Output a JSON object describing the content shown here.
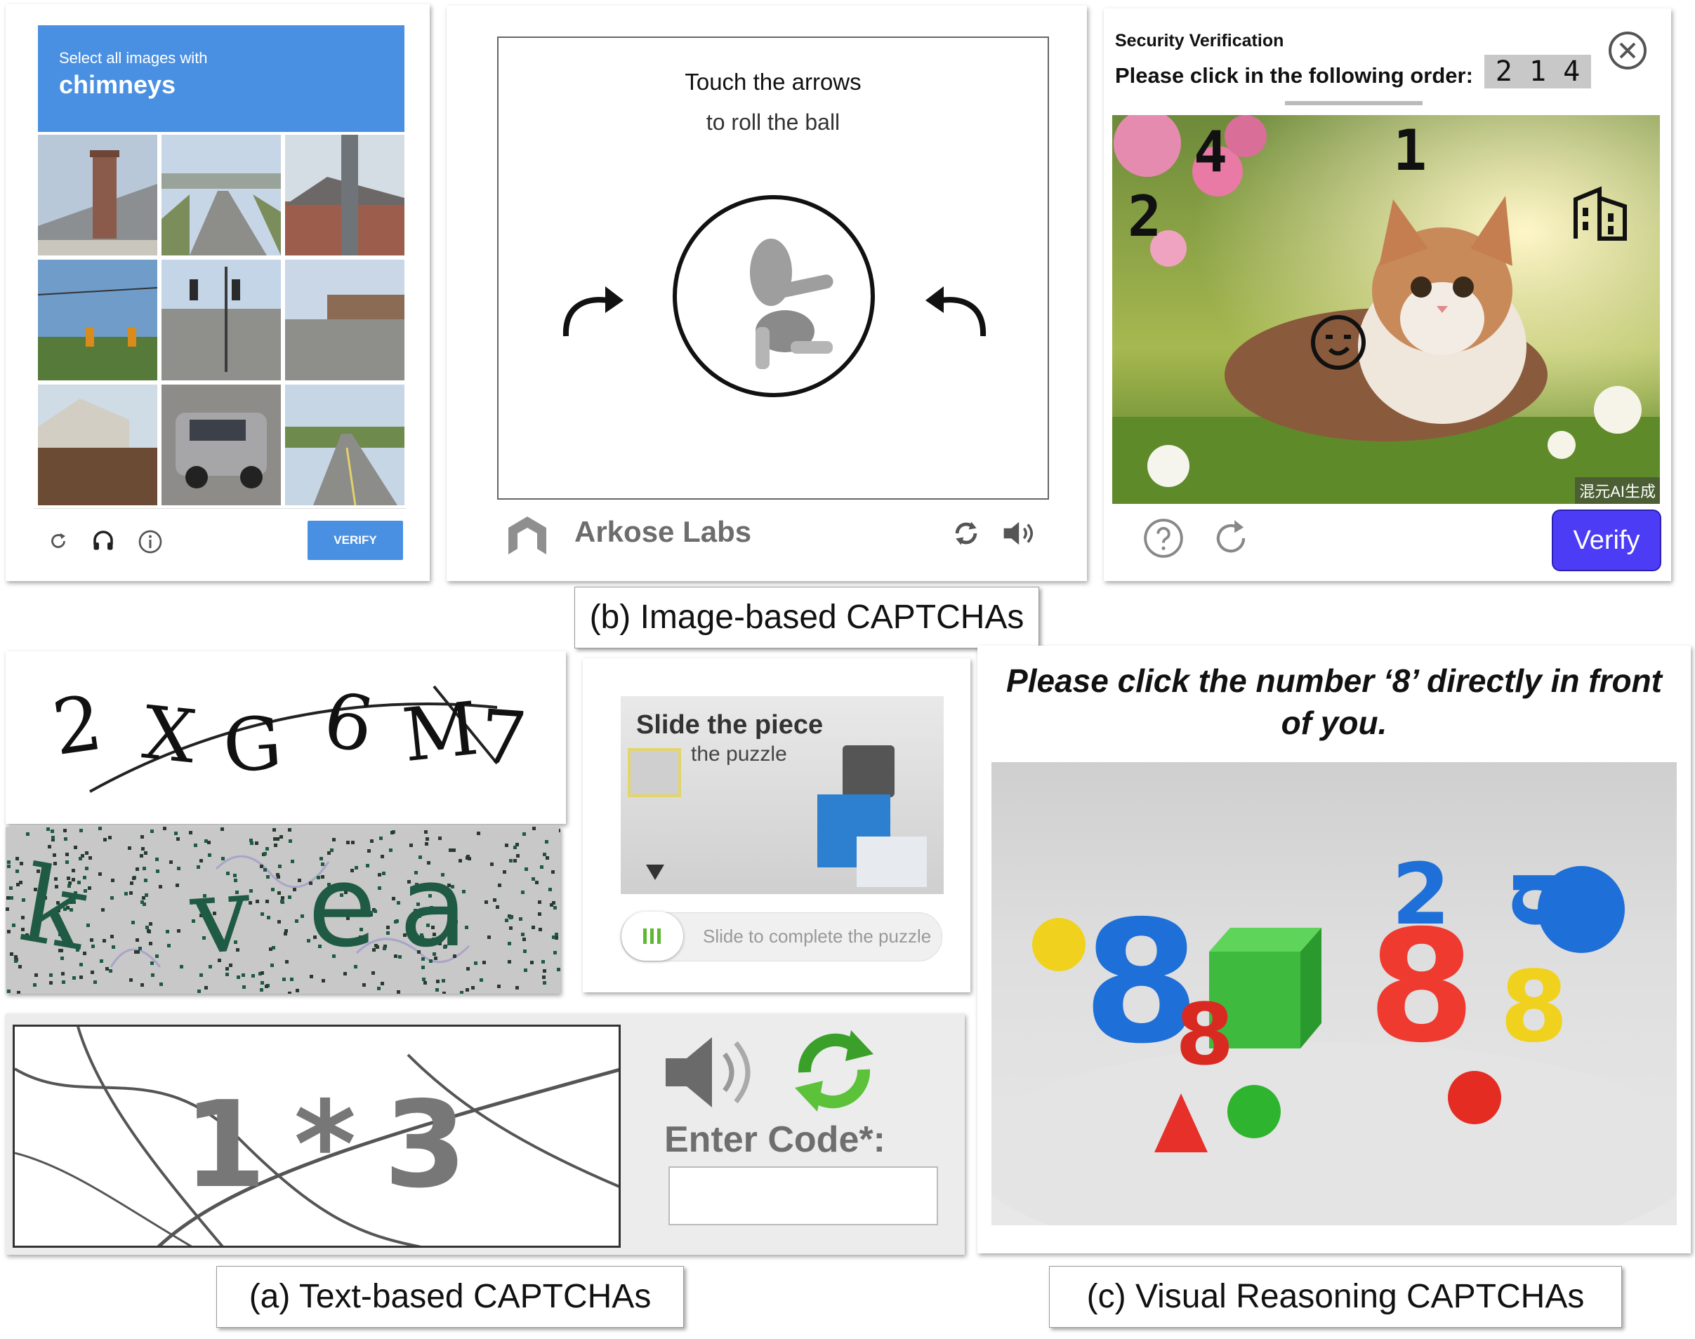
{
  "recaptcha": {
    "instruction": "Select all images with",
    "target": "chimneys",
    "verify_label": "VERIFY",
    "icons": [
      "reload-icon",
      "headphones-icon",
      "info-icon"
    ],
    "accent": "#4a90e2"
  },
  "arkose": {
    "title": "Touch the arrows",
    "subtitle": "to roll the ball",
    "brand": "Arkose Labs",
    "icons": [
      "refresh-icon",
      "speaker-icon"
    ]
  },
  "security": {
    "title": "Security Verification",
    "instruction": "Please click in the following order:",
    "order_code": "2 1 4",
    "digits": [
      "2",
      "4",
      "1"
    ],
    "watermark": "混元AI生成",
    "verify_label": "Verify",
    "accent": "#4c3cf5",
    "icons": [
      "close-icon",
      "help-icon",
      "refresh-icon",
      "building-icon",
      "smiley-icon"
    ]
  },
  "captions": {
    "b": "(b) Image-based CAPTCHAs",
    "a": "(a) Text-based CAPTCHAs",
    "c": "(c) Visual Reasoning CAPTCHAs"
  },
  "text_captcha_1": {
    "chars": [
      "2",
      "X",
      "G",
      "6",
      "M",
      "7"
    ]
  },
  "text_captcha_2": {
    "chars": [
      "k",
      "v",
      "e",
      "a"
    ],
    "color": "#1e5a44"
  },
  "slide_puzzle": {
    "title": "Slide the piece",
    "subtitle": "the puzzle",
    "slider_label": "Slide to complete the puzzle"
  },
  "math_captcha": {
    "expression": "1 * 3",
    "enter_label": "Enter Code*:",
    "input_value": "",
    "icons": [
      "speaker-icon",
      "refresh-icon"
    ]
  },
  "visual_reasoning": {
    "question": "Please click the number ‘8’ directly in front of you.",
    "objects": [
      "8",
      "8",
      "8",
      "8",
      "2",
      "g"
    ]
  }
}
